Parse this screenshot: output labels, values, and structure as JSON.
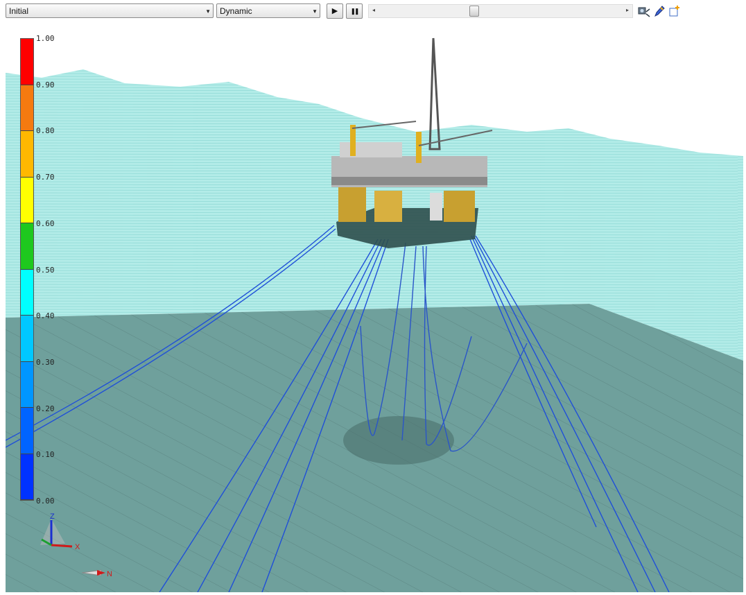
{
  "toolbar": {
    "case_select": "Initial",
    "mode_select": "Dynamic",
    "play_label": "▶",
    "pause_label": "❚❚",
    "icons": [
      "camera-settings-icon",
      "pen-icon",
      "new-window-icon"
    ]
  },
  "legend": {
    "ticks": [
      "1.00",
      "0.90",
      "0.80",
      "0.70",
      "0.60",
      "0.50",
      "0.40",
      "0.30",
      "0.20",
      "0.10",
      "0.00"
    ],
    "colors": [
      "#ff0000",
      "#f57a10",
      "#ffb800",
      "#ffff00",
      "#1ec81e",
      "#00ffff",
      "#00c8ff",
      "#0096ff",
      "#0064ff",
      "#0032ff"
    ]
  },
  "axes": {
    "z": "Z",
    "x": "X",
    "north": "N"
  },
  "scene": {
    "sea_color": "#a8e8e4",
    "seabed_color": "#6f9e9a",
    "riser_color": "#1f4fd8"
  }
}
